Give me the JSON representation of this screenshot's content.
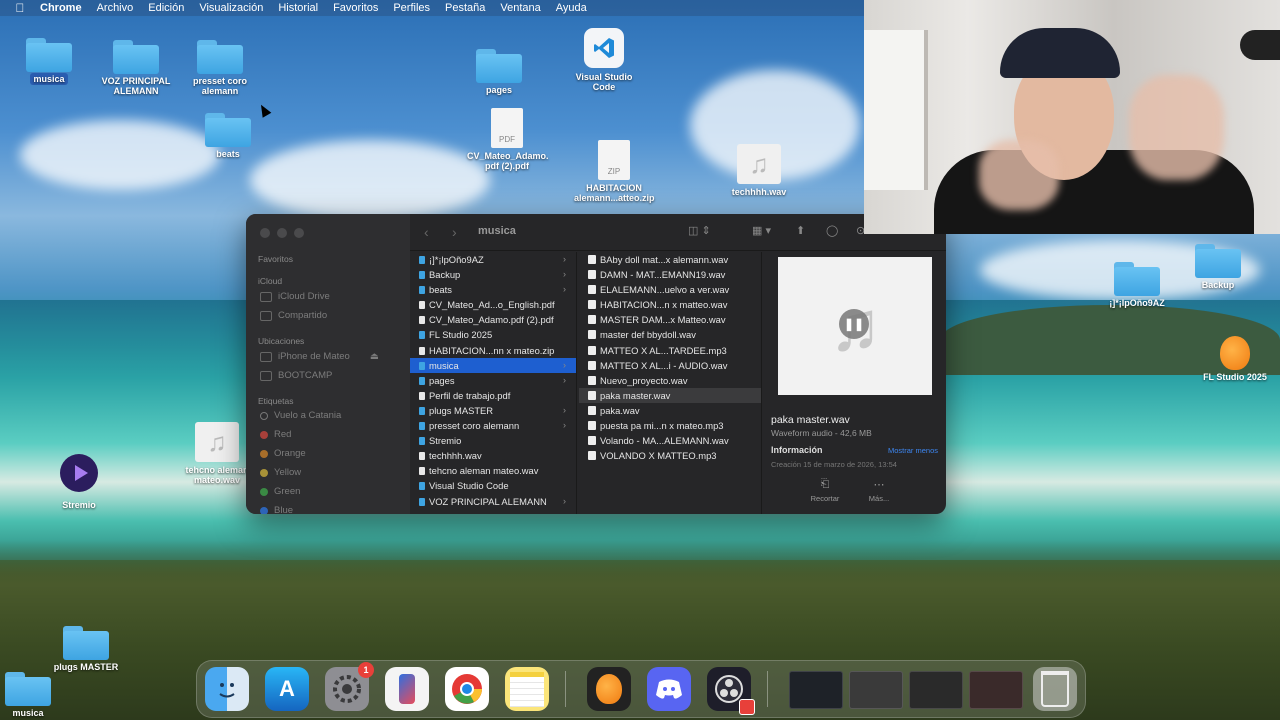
{
  "menubar": {
    "items": [
      "Chrome",
      "Archivo",
      "Edición",
      "Visualización",
      "Historial",
      "Favoritos",
      "Perfiles",
      "Pestaña",
      "Ventana",
      "Ayuda"
    ]
  },
  "desktop": {
    "icons": {
      "musica": "musica",
      "voz": "VOZ PRINCIPAL ALEMANN",
      "presset": "presset coro alemann",
      "beats": "beats",
      "pages": "pages",
      "cv": "CV_Mateo_Adamo. pdf (2).pdf",
      "vscode": "Visual Studio Code",
      "habitacion": "HABITACION alemann...atteo.zip",
      "techhhh": "techhhh.wav",
      "jpono": "¡]*¡lpOño9AZ",
      "backup": "Backup",
      "flstudio": "FL Studio 2025",
      "tehcno": "tehcno aleman mateo.wav",
      "stremio": "Stremio",
      "plugs": "plugs MASTER",
      "musica2": "musica"
    },
    "pdf_tag": "PDF",
    "zip_tag": "ZIP"
  },
  "finder": {
    "title": "musica",
    "sidebar": {
      "favoritos": "Favoritos",
      "icloud": "iCloud",
      "icloud_drive": "iCloud Drive",
      "compartido": "Compartido",
      "ubicaciones": "Ubicaciones",
      "iphone": "iPhone de Mateo",
      "bootcamp": "BOOTCAMP",
      "etiquetas": "Etiquetas",
      "tags": [
        "Vuelo a Catania",
        "Red",
        "Orange",
        "Yellow",
        "Green",
        "Blue"
      ]
    },
    "column1": [
      "¡]*¡lpOño9AZ",
      "Backup",
      "beats",
      "CV_Mateo_Ad...o_English.pdf",
      "CV_Mateo_Adamo.pdf (2).pdf",
      "FL Studio 2025",
      "HABITACION...nn x mateo.zip",
      "musica",
      "pages",
      "Perfil de trabajo.pdf",
      "plugs MASTER",
      "presset coro alemann",
      "Stremio",
      "techhhh.wav",
      "tehcno aleman mateo.wav",
      "Visual Studio Code",
      "VOZ PRINCIPAL ALEMANN"
    ],
    "column2": [
      "BAby doll mat...x alemann.wav",
      "DAMN - MAT...EMANN19.wav",
      "ELALEMANN...uelvo a ver.wav",
      "HABITACION...n x matteo.wav",
      "MASTER DAM...x Matteo.wav",
      "master def bbydoll.wav",
      "MATTEO X AL...TARDEE.mp3",
      "MATTEO X AL...i - AUDIO.wav",
      "Nuevo_proyecto.wav",
      "paka master.wav",
      "paka.wav",
      "puesta pa mi...n x mateo.mp3",
      "Volando - MA...ALEMANN.wav",
      "VOLANDO X MATTEO.mp3"
    ],
    "preview": {
      "name": "paka master.wav",
      "kind": "Waveform audio - 42,6 MB",
      "info": "Información",
      "more": "Mostrar menos",
      "created": "Creación      15 de marzo de 2026, 13:54",
      "action1": "Recortar",
      "action2": "Más..."
    }
  },
  "dock": {
    "settings_badge": "1"
  },
  "colors": {
    "selection": "#1e5fd0",
    "folder": "#4fb1ea",
    "tag_red": "#e0443b",
    "tag_orange": "#f0932b",
    "tag_yellow": "#f2c94c",
    "tag_green": "#3fb950",
    "tag_blue": "#3d86f0"
  }
}
